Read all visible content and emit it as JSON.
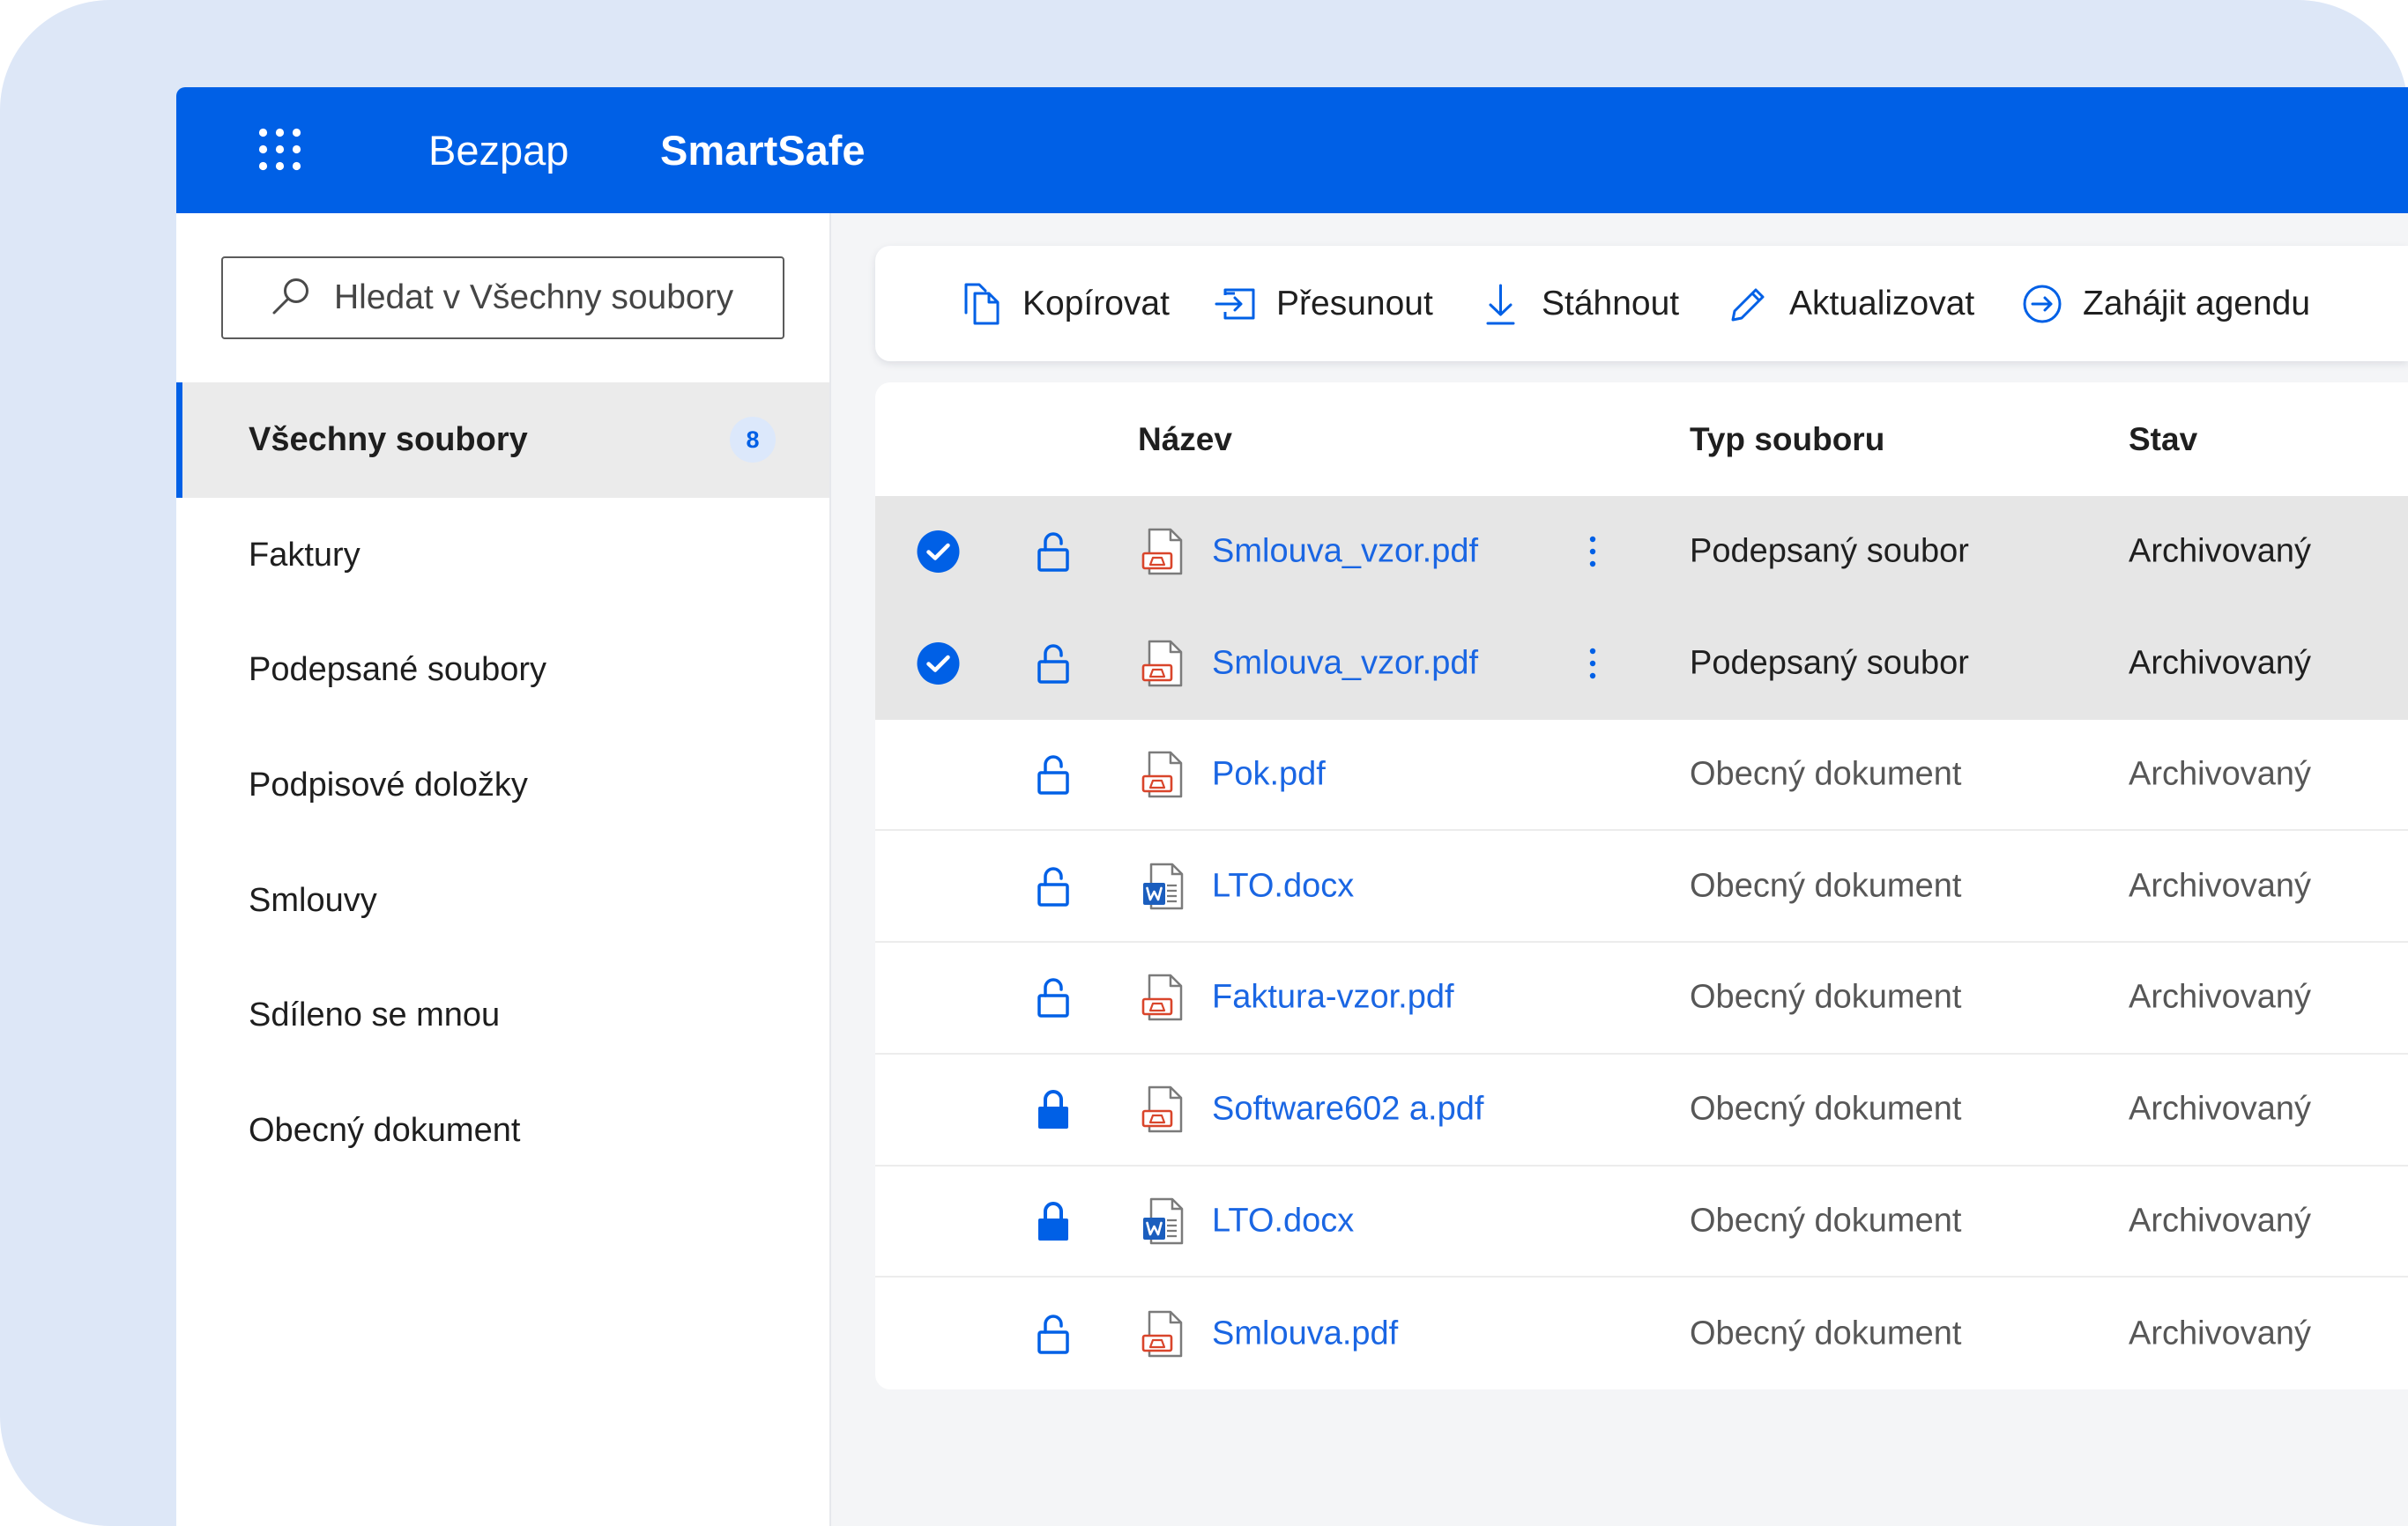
{
  "app": {
    "brand": "Bezpap",
    "product": "SmartSafe",
    "apps_icon": "apps-grid-icon"
  },
  "colors": {
    "accent": "#0060e6",
    "link": "#1a66e3",
    "backdrop": "#dde7f7",
    "selected_row": "#e6e6e6",
    "active_nav": "#ebebeb",
    "badge_bg": "#dce8fb",
    "pdf_mark": "#d9452b",
    "word_mark": "#1b5ebe"
  },
  "search": {
    "icon": "search-icon",
    "placeholder": "Hledat v Všechny soubory"
  },
  "sidebar": {
    "items": [
      {
        "label": "Všechny soubory",
        "badge": "8",
        "active": true
      },
      {
        "label": "Faktury"
      },
      {
        "label": "Podepsané soubory"
      },
      {
        "label": "Podpisové doložky"
      },
      {
        "label": "Smlouvy"
      },
      {
        "label": "Sdíleno se mnou"
      },
      {
        "label": "Obecný dokument"
      }
    ]
  },
  "toolbar": {
    "actions": [
      {
        "label": "Kopírovat",
        "icon": "copy-icon"
      },
      {
        "label": "Přesunout",
        "icon": "move-icon"
      },
      {
        "label": "Stáhnout",
        "icon": "download-icon"
      },
      {
        "label": "Aktualizovat",
        "icon": "pencil-icon"
      },
      {
        "label": "Zahájit agendu",
        "icon": "start-agenda-icon"
      }
    ]
  },
  "table": {
    "columns": {
      "name": "Název",
      "type": "Typ souboru",
      "status": "Stav"
    },
    "rows": [
      {
        "selected": true,
        "lock_icon": "unlocked-lock-icon",
        "file_icon": "pdf-file-icon",
        "name": "Smlouva_vzor.pdf",
        "menu_icon": "kebab-menu-icon",
        "type": "Podepsaný soubor",
        "status": "Archivovaný"
      },
      {
        "selected": true,
        "lock_icon": "unlocked-lock-icon",
        "file_icon": "pdf-file-icon",
        "name": "Smlouva_vzor.pdf",
        "menu_icon": "kebab-menu-icon",
        "type": "Podepsaný soubor",
        "status": "Archivovaný"
      },
      {
        "selected": false,
        "lock_icon": "unlocked-lock-icon",
        "file_icon": "pdf-file-icon",
        "name": "Pok.pdf",
        "type": "Obecný dokument",
        "status": "Archivovaný"
      },
      {
        "selected": false,
        "lock_icon": "unlocked-lock-icon",
        "file_icon": "word-file-icon",
        "name": "LTO.docx",
        "type": "Obecný dokument",
        "status": "Archivovaný"
      },
      {
        "selected": false,
        "lock_icon": "unlocked-lock-icon",
        "file_icon": "pdf-file-icon",
        "name": "Faktura-vzor.pdf",
        "type": "Obecný dokument",
        "status": "Archivovaný"
      },
      {
        "selected": false,
        "lock_icon": "locked-lock-icon",
        "file_icon": "pdf-file-icon",
        "name": "Software602 a.pdf",
        "type": "Obecný dokument",
        "status": "Archivovaný"
      },
      {
        "selected": false,
        "lock_icon": "locked-lock-icon",
        "file_icon": "word-file-icon",
        "name": "LTO.docx",
        "type": "Obecný dokument",
        "status": "Archivovaný"
      },
      {
        "selected": false,
        "lock_icon": "unlocked-lock-icon",
        "file_icon": "pdf-file-icon",
        "name": "Smlouva.pdf",
        "type": "Obecný dokument",
        "status": "Archivovaný"
      }
    ]
  }
}
